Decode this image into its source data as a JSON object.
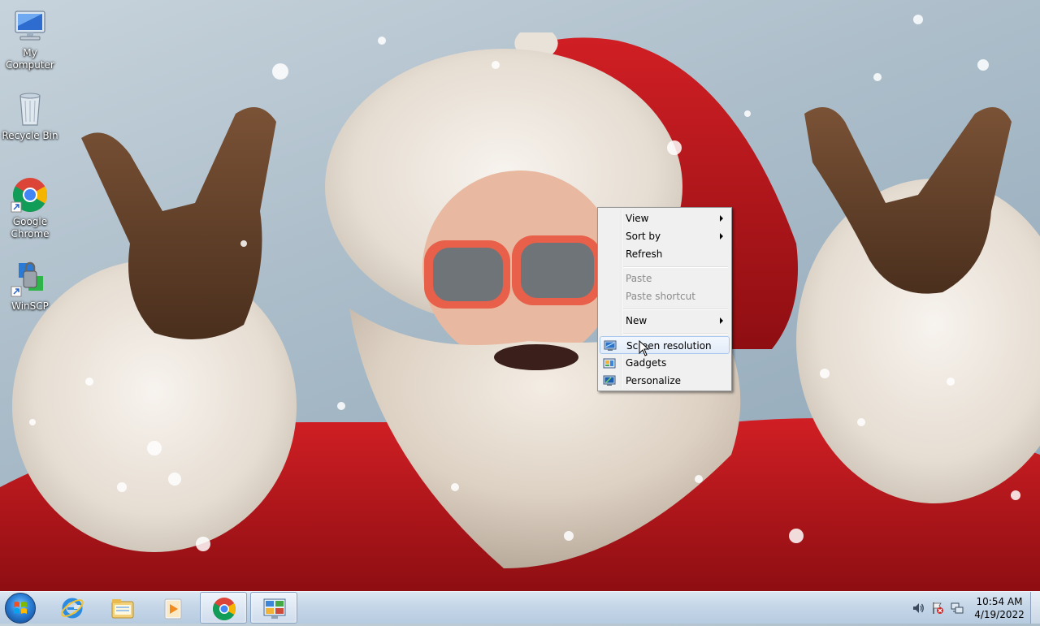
{
  "desktop": {
    "icons": [
      {
        "label_line1": "My",
        "label_line2": "Computer",
        "icon": "computer-icon"
      },
      {
        "label_line1": "Recycle Bin",
        "label_line2": "",
        "icon": "recycle-bin-icon"
      },
      {
        "label_line1": "Google",
        "label_line2": "Chrome",
        "icon": "chrome-icon"
      },
      {
        "label_line1": "WinSCP",
        "label_line2": "",
        "icon": "winscp-icon"
      }
    ]
  },
  "context_menu": {
    "items": [
      {
        "label": "View",
        "submenu": true,
        "enabled": true
      },
      {
        "label": "Sort by",
        "submenu": true,
        "enabled": true
      },
      {
        "label": "Refresh",
        "submenu": false,
        "enabled": true
      },
      {
        "label": "Paste",
        "submenu": false,
        "enabled": false
      },
      {
        "label": "Paste shortcut",
        "submenu": false,
        "enabled": false
      },
      {
        "label": "New",
        "submenu": true,
        "enabled": true
      },
      {
        "label": "Screen resolution",
        "submenu": false,
        "enabled": true,
        "icon": "monitor-icon",
        "highlighted": true
      },
      {
        "label": "Gadgets",
        "submenu": false,
        "enabled": true,
        "icon": "gadgets-icon"
      },
      {
        "label": "Personalize",
        "submenu": false,
        "enabled": true,
        "icon": "personalize-icon"
      }
    ]
  },
  "taskbar": {
    "pinned": [
      {
        "icon": "internet-explorer-icon"
      },
      {
        "icon": "file-explorer-icon"
      },
      {
        "icon": "media-player-icon"
      },
      {
        "icon": "chrome-icon",
        "active": true
      },
      {
        "icon": "control-panel-icon",
        "active": true
      }
    ],
    "tray": {
      "icons": [
        "volume-icon",
        "action-center-flag-icon",
        "network-icon"
      ],
      "time": "10:54 AM",
      "date": "4/19/2022"
    }
  },
  "colors": {
    "menu_bg": "#f0f0f0",
    "menu_highlight": "#a8c7ee",
    "taskbar": "#c5d6e8",
    "santa_red": "#c4161c"
  }
}
